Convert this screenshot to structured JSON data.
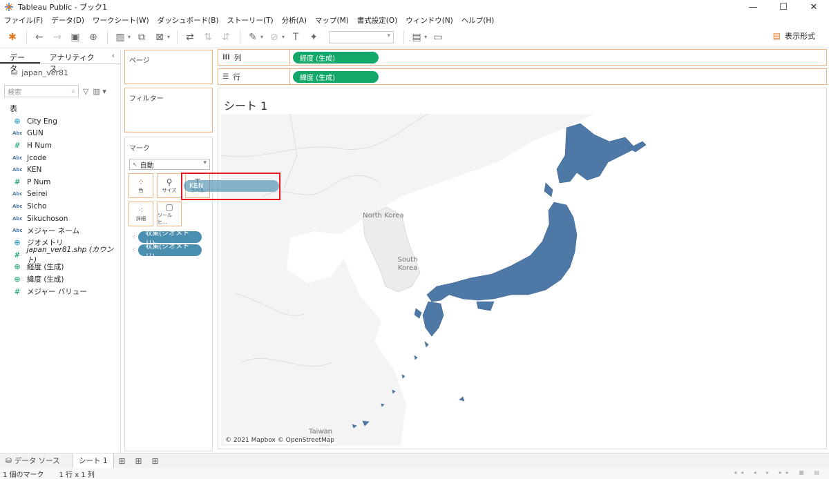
{
  "window": {
    "title": "Tableau Public - ブック1"
  },
  "menu": [
    "ファイル(F)",
    "データ(D)",
    "ワークシート(W)",
    "ダッシュボード(B)",
    "ストーリー(T)",
    "分析(A)",
    "マップ(M)",
    "書式設定(O)",
    "ウィンドウ(N)",
    "ヘルプ(H)"
  ],
  "toolbar": {
    "show_me": "表示形式"
  },
  "data_pane": {
    "tabs": [
      "データ",
      "アナリティクス"
    ],
    "datasource": "japan_ver81",
    "search_placeholder": "検索",
    "table_header": "表",
    "fields": [
      {
        "icon": "globe",
        "label": "City Eng"
      },
      {
        "icon": "abc",
        "label": "GUN"
      },
      {
        "icon": "hash",
        "label": "H Num"
      },
      {
        "icon": "abc",
        "label": "Jcode"
      },
      {
        "icon": "abc",
        "label": "KEN"
      },
      {
        "icon": "hash",
        "label": "P Num"
      },
      {
        "icon": "abc",
        "label": "Seirei"
      },
      {
        "icon": "abc",
        "label": "Sicho"
      },
      {
        "icon": "abc",
        "label": "Sikuchoson"
      },
      {
        "icon": "abc",
        "label": "メジャー ネーム"
      },
      {
        "icon": "globe",
        "label": "ジオメトリ"
      },
      {
        "icon": "hash",
        "label": "japan_ver81.shp (カウント)"
      },
      {
        "icon": "globe",
        "label": "経度 (生成)"
      },
      {
        "icon": "globe",
        "label": "緯度 (生成)"
      },
      {
        "icon": "hash",
        "label": "メジャー バリュー"
      }
    ]
  },
  "shelves": {
    "pages": "ページ",
    "filters": "フィルター",
    "marks": "マーク",
    "mark_type": "自動",
    "mark_buttons": [
      "色",
      "サイズ",
      "ラベル",
      "詳細",
      "ツールヒ..."
    ],
    "mark_pills": [
      "収集(ジオメトリ)",
      "収集(ジオメトリ)"
    ],
    "columns_label": "列",
    "rows_label": "行",
    "columns_pill": "経度 (生成)",
    "rows_pill": "緯度 (生成)"
  },
  "drag_pill": "KEN",
  "sheet": {
    "title": "シート 1",
    "map_labels": [
      "North Korea",
      "South Korea",
      "Taiwan"
    ],
    "copyright": "© 2021 Mapbox © OpenStreetMap"
  },
  "bottom": {
    "datasource_tab": "データ ソース",
    "sheet_tab": "シート 1",
    "status": [
      "1 個のマーク",
      "1 行 x 1 列"
    ]
  },
  "colors": {
    "green_pill": "#13a86a",
    "blue_pill": "#4b8fb0",
    "shelf_border": "#f0b27e",
    "highlight": "#e8161c",
    "land": "#4e79a7"
  }
}
